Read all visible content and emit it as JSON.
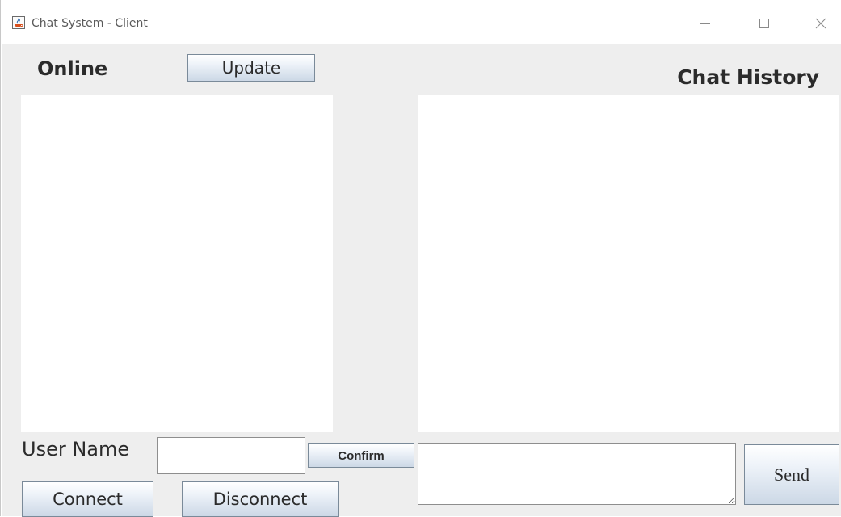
{
  "window": {
    "title": "Chat System - Client",
    "icon": "java-coffee-cup-icon",
    "controls": [
      "minimize-icon",
      "maximize-icon",
      "close-icon"
    ]
  },
  "online": {
    "label": "Online",
    "update_label": "Update",
    "users": []
  },
  "history": {
    "label": "Chat History",
    "messages": []
  },
  "user": {
    "name_label": "User Name",
    "name_value": "",
    "confirm_label": "Confirm",
    "connect_label": "Connect",
    "disconnect_label": "Disconnect"
  },
  "composer": {
    "message_value": "",
    "send_label": "Send"
  },
  "colors": {
    "client_background": "#eeeeee",
    "panel_background": "#ffffff",
    "button_gradient_bottom": "#ccd8e6",
    "button_border": "#7a8a99"
  }
}
